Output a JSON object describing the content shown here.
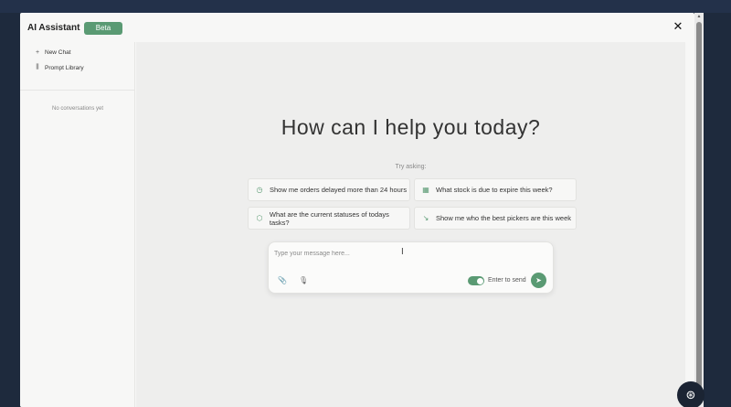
{
  "header": {
    "title": "AI Assistant",
    "badge": "Beta",
    "close_label": "✕"
  },
  "sidebar": {
    "items": [
      {
        "icon": "plus-icon",
        "glyph": "+",
        "label": "New Chat"
      },
      {
        "icon": "library-icon",
        "glyph": "⫼",
        "label": "Prompt Library"
      }
    ],
    "empty_text": "No conversations yet"
  },
  "main": {
    "headline": "How can I help you today?",
    "try_asking": "Try asking:",
    "suggestions": [
      {
        "icon": "clock-icon",
        "glyph": "◷",
        "label": "Show me orders delayed more than 24 hours"
      },
      {
        "icon": "calendar-icon",
        "glyph": "▦",
        "label": "What stock is due to expire this week?"
      },
      {
        "icon": "box-icon",
        "glyph": "⬡",
        "label": "What are the current statuses of todays tasks?"
      },
      {
        "icon": "trend-down-icon",
        "glyph": "↘",
        "label": "Show me who the best pickers are this week"
      }
    ]
  },
  "composer": {
    "placeholder": "Type your message here...",
    "value": "",
    "attach_glyph": "📎",
    "mic_glyph": "🎙",
    "toggle_label": "Enter to send",
    "toggle_on": true,
    "send_glyph": "➤"
  },
  "help_glyph": "⊛",
  "colors": {
    "accent": "#5a9a73",
    "backdrop": "#1e2a3d"
  }
}
